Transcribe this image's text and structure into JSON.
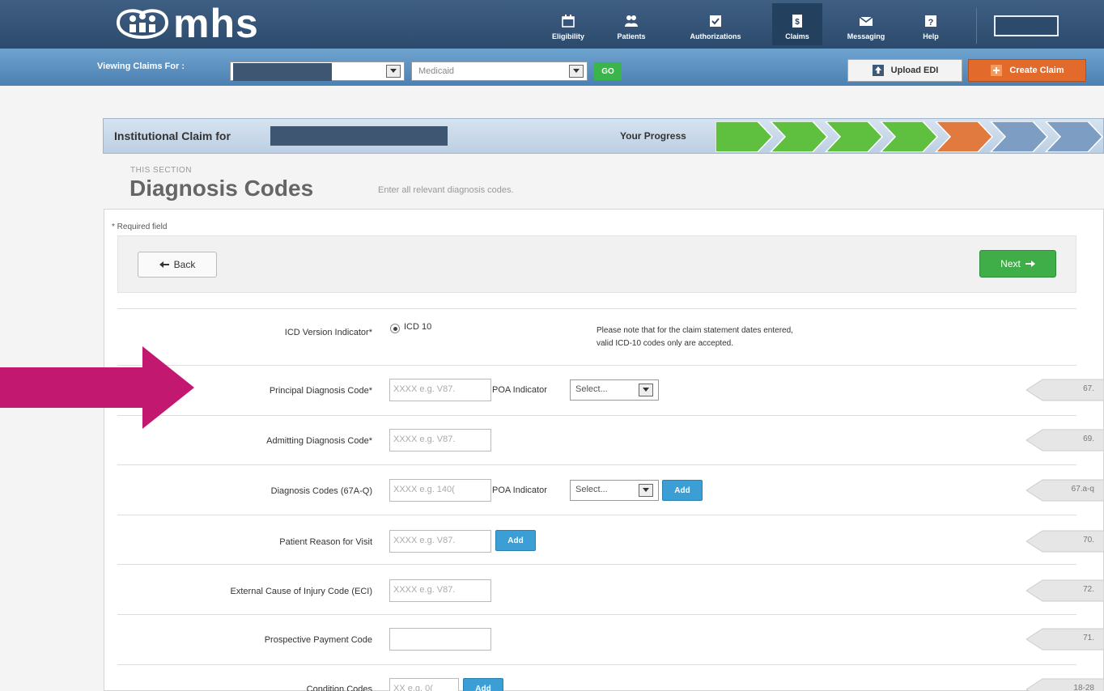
{
  "header": {
    "brand": "mhs",
    "nav": [
      {
        "label": "Eligibility",
        "icon": "calendar-icon"
      },
      {
        "label": "Patients",
        "icon": "patients-icon"
      },
      {
        "label": "Authorizations",
        "icon": "check-icon"
      },
      {
        "label": "Claims",
        "icon": "claims-icon"
      },
      {
        "label": "Messaging",
        "icon": "envelope-icon"
      },
      {
        "label": "Help",
        "icon": "help-icon"
      }
    ],
    "active_nav": "Claims"
  },
  "toolbar": {
    "viewing_label": "Viewing Claims For :",
    "plan_value": "Medicaid",
    "go_label": "GO",
    "upload_label": "Upload EDI",
    "create_label": "Create Claim"
  },
  "claim": {
    "title": "Institutional Claim for",
    "progress_label": "Your Progress",
    "progress_steps": [
      "done",
      "done",
      "done",
      "done",
      "current",
      "todo",
      "todo"
    ]
  },
  "section": {
    "eyebrow": "THIS SECTION",
    "title": "Diagnosis Codes",
    "description": "Enter all relevant diagnosis codes."
  },
  "form": {
    "required_note": "* Required field",
    "back_label": "Back",
    "next_label": "Next",
    "icd_label": "ICD Version Indicator*",
    "icd_value": "ICD 10",
    "note_line1": "Please note that for the claim statement dates entered,",
    "note_line2": "valid ICD-10 codes only are accepted.",
    "poa_label": "POA Indicator",
    "poa_select": "Select...",
    "add_label": "Add",
    "rows": [
      {
        "label": "Principal Diagnosis Code*",
        "placeholder": "XXXX e.g. V87.",
        "tag": "67."
      },
      {
        "label": "Admitting Diagnosis Code*",
        "placeholder": "XXXX e.g. V87.",
        "tag": "69."
      },
      {
        "label": "Diagnosis Codes (67A-Q)",
        "placeholder": "XXXX e.g. 140(",
        "tag": "67.a-q"
      },
      {
        "label": "Patient Reason for Visit",
        "placeholder": "XXXX e.g. V87.",
        "tag": "70."
      },
      {
        "label": "External Cause of Injury Code (ECI)",
        "placeholder": "XXXX e.g. V87.",
        "tag": "72."
      },
      {
        "label": "Prospective Payment Code",
        "placeholder": "",
        "tag": "71."
      },
      {
        "label": "Condition Codes",
        "placeholder": "XX e.g. 0(",
        "tag": "18-28"
      }
    ]
  },
  "colors": {
    "header_bg": "#2c4a6c",
    "subbar_bg": "#5b8fc0",
    "progress_done": "#5fbf3f",
    "progress_current": "#e07a3f",
    "progress_todo": "#7d9ec2",
    "arrow": "#c2186f",
    "next_button": "#3fae49",
    "create_button": "#e26b2b",
    "add_button": "#3b9fd6"
  }
}
